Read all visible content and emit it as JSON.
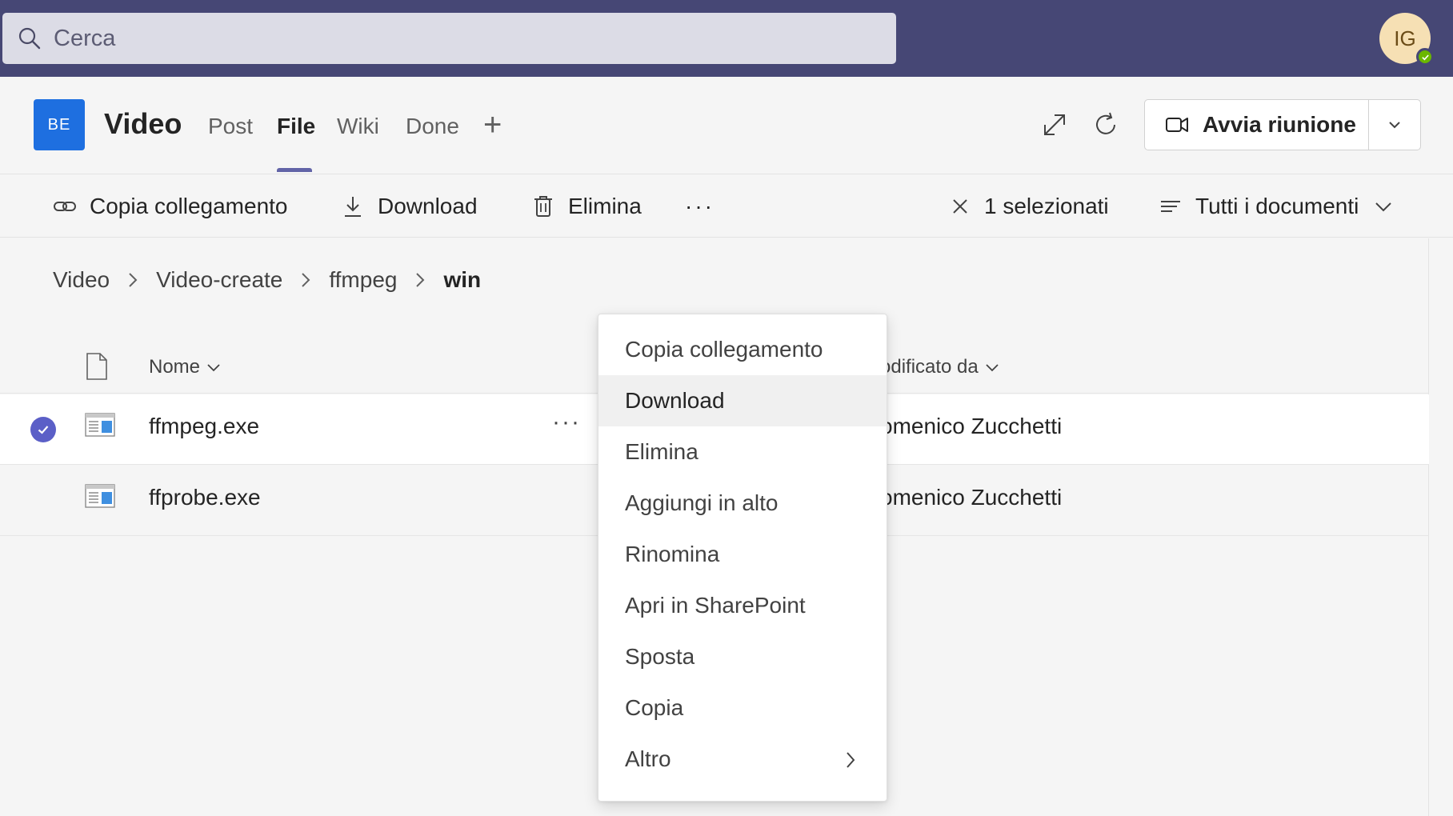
{
  "search": {
    "placeholder": "Cerca"
  },
  "user": {
    "initials": "IG",
    "presence": "available"
  },
  "channel": {
    "team_badge": "BE",
    "title": "Video",
    "tabs": [
      {
        "label": "Post",
        "active": false
      },
      {
        "label": "File",
        "active": true
      },
      {
        "label": "Wiki",
        "active": false
      },
      {
        "label": "Done",
        "active": false
      }
    ],
    "add_tab": "+",
    "meet_label": "Avvia riunione"
  },
  "commands": {
    "copy_link": "Copia collegamento",
    "download": "Download",
    "delete": "Elimina",
    "more": "···",
    "selected_count": "1 selezionati",
    "view": "Tutti i documenti"
  },
  "breadcrumb": [
    "Video",
    "Video-create",
    "ffmpeg",
    "win"
  ],
  "list": {
    "columns": {
      "name": "Nome",
      "modified_by": "Modificato da"
    },
    "modified_by_visible": "odificato da",
    "rows": [
      {
        "name": "ffmpeg.exe",
        "selected": true,
        "more": "···",
        "modified_by": "Domenico Zucchetti",
        "modified_by_visible": "omenico Zucchetti"
      },
      {
        "name": "ffprobe.exe",
        "selected": false,
        "modified_by": "Domenico Zucchetti",
        "modified_by_visible": "omenico Zucchetti"
      }
    ]
  },
  "context_menu": {
    "items": [
      {
        "label": "Copia collegamento"
      },
      {
        "label": "Download",
        "highlighted": true
      },
      {
        "label": "Elimina"
      },
      {
        "label": "Aggiungi in alto"
      },
      {
        "label": "Rinomina"
      },
      {
        "label": "Apri in SharePoint"
      },
      {
        "label": "Sposta"
      },
      {
        "label": "Copia"
      },
      {
        "label": "Altro",
        "has_submenu": true
      }
    ]
  },
  "colors": {
    "titlebar": "#464775",
    "accent": "#6264a7",
    "team_badge": "#1e6fe0",
    "check": "#5b5fc7",
    "presence": "#6bb700"
  }
}
